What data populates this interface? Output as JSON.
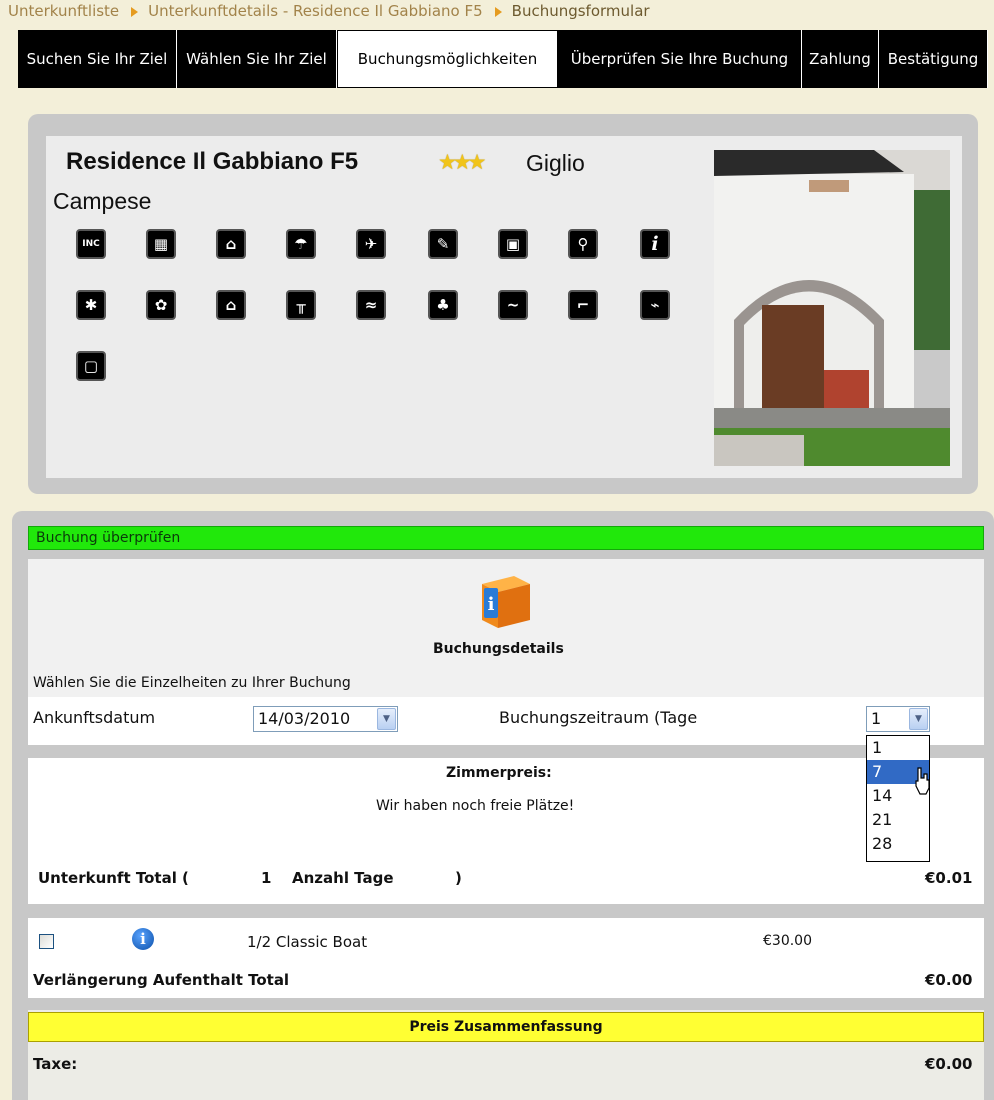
{
  "breadcrumb": {
    "items": [
      {
        "label": "Unterkunftliste"
      },
      {
        "label": "Unterkunftdetails - Residence Il Gabbiano F5"
      },
      {
        "label": "Buchungsformular"
      }
    ]
  },
  "tabs": [
    {
      "label": "Suchen Sie Ihr Ziel"
    },
    {
      "label": "Wählen Sie Ihr Ziel"
    },
    {
      "label": "Buchungsmöglichkeiten"
    },
    {
      "label": "Überprüfen Sie Ihre Buchung"
    },
    {
      "label": "Zahlung"
    },
    {
      "label": "Bestätigung"
    }
  ],
  "hotel": {
    "name": "Residence Il Gabbiano F5",
    "stars": "★★★",
    "location": "Giglio",
    "region": "Campese",
    "amenities": [
      "INC",
      "▦",
      "⌂",
      "☂",
      "✈",
      "✎",
      "▣",
      "⚲",
      "i",
      "✱",
      "✿",
      "⌂",
      "╥",
      "≈",
      "♣",
      "~",
      "⌐",
      "⌁",
      "▢"
    ]
  },
  "booking": {
    "header": "Buchung überprüfen",
    "details_title": "Buchungsdetails",
    "instructions": "Wählen Sie die Einzelheiten zu Ihrer Buchung",
    "arrival_label": "Ankunftsdatum",
    "arrival_value": "14/03/2010",
    "period_label": "Buchungszeitraum (Tage",
    "period_value": "1",
    "period_options": [
      "1",
      "7",
      "14",
      "21",
      "28"
    ]
  },
  "price": {
    "title": "Zimmerpreis:",
    "availability": "Wir haben noch freie Plätze!",
    "total_label": "Unterkunft Total (",
    "total_days": "1",
    "total_days_label": "Anzahl Tage",
    "total_close": ")",
    "total_value": "€0.01"
  },
  "extras": {
    "item_label": "1/2 Classic Boat",
    "item_price": "€30.00",
    "total_label": "Verlängerung Aufenthalt Total",
    "total_value": "€0.00"
  },
  "summary": {
    "title": "Preis Zusammenfassung",
    "tax_label": "Taxe:",
    "tax_value": "€0.00"
  },
  "colors": {
    "green_header": "#21e80b",
    "yellow_header": "#ffff33",
    "selected_option": "#316ac5"
  }
}
